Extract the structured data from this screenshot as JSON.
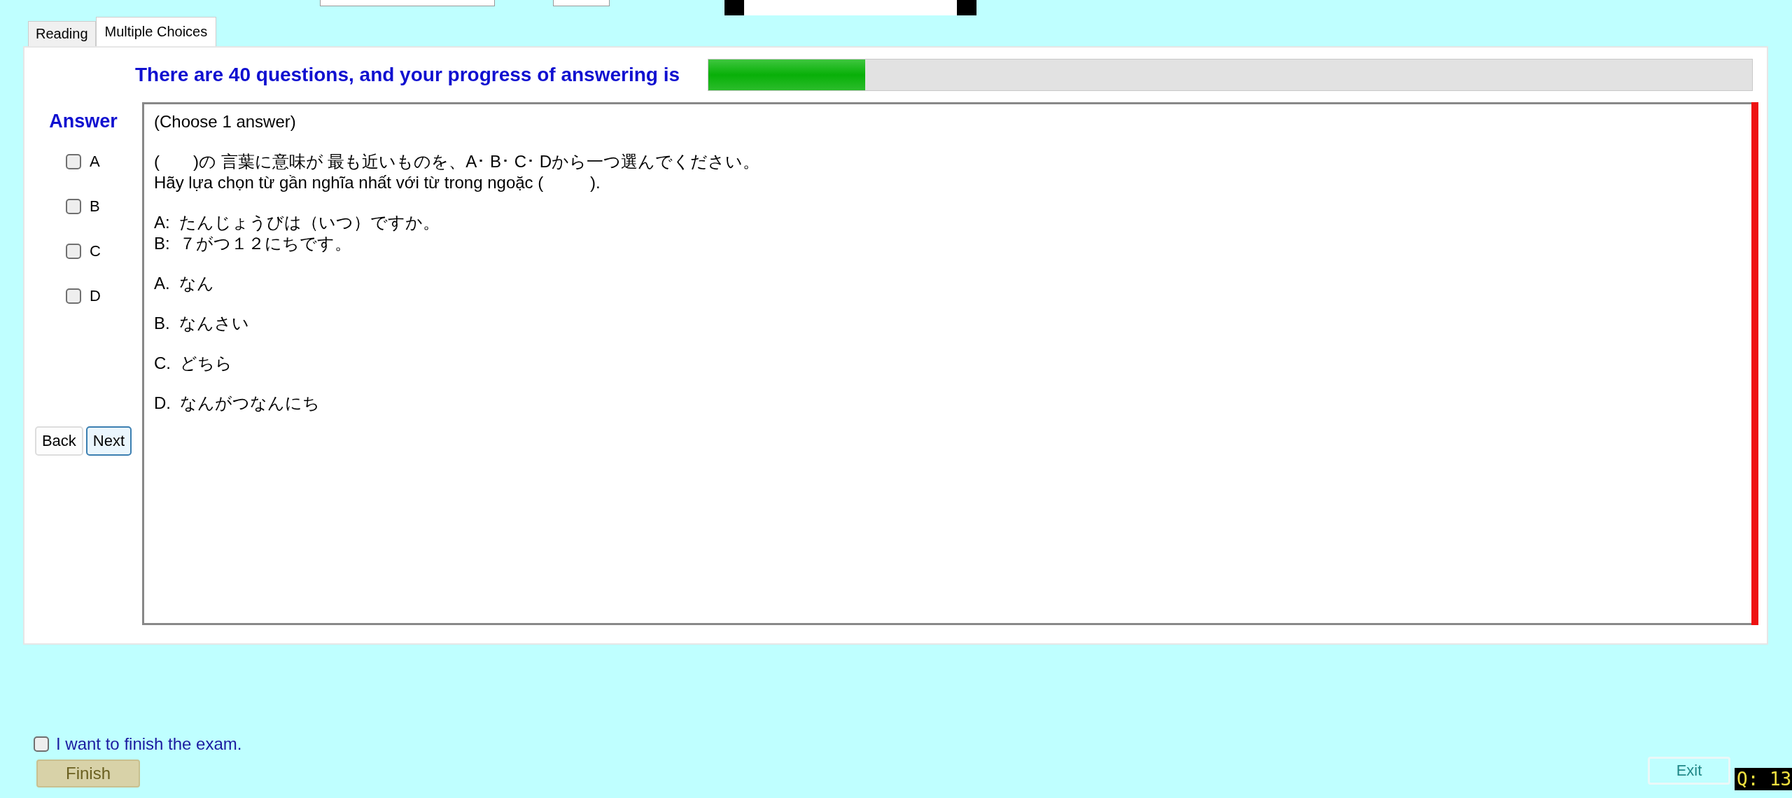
{
  "tabs": [
    {
      "label": "Reading",
      "selected": false
    },
    {
      "label": "Multiple Choices",
      "selected": true
    }
  ],
  "progress": {
    "label": "There are 40 questions, and your progress of answering is",
    "level": 0.15
  },
  "answer": {
    "title": "Answer",
    "choices": [
      {
        "label": "A",
        "checked": false
      },
      {
        "label": "B",
        "checked": false
      },
      {
        "label": "C",
        "checked": false
      },
      {
        "label": "D",
        "checked": false
      }
    ]
  },
  "nav_buttons": [
    {
      "label": "Back",
      "focused": false
    },
    {
      "label": "Next",
      "focused": true
    }
  ],
  "question": {
    "paragraphs": [
      [
        "(Choose 1 answer)"
      ],
      [
        "(　　)の 言葉に意味が 最も近いものを、A･ B･ C･ Dから一つ選んでください。",
        "Hãy lựa chọn từ gần nghĩa nhất với từ trong ngoặc (          )."
      ],
      [
        "A:  たんじょうびは（いつ）ですか。",
        "B:  ７がつ１２にちです。"
      ],
      [
        "A.  なん"
      ],
      [
        "B.  なんさい"
      ],
      [
        "C.  どちら"
      ],
      [
        "D.  なんがつなんにち"
      ]
    ]
  },
  "finish": {
    "label": "I want to finish the exam.",
    "checked": false,
    "button": "Finish"
  },
  "exit_button": "Exit",
  "question_counter": "Q: 13"
}
